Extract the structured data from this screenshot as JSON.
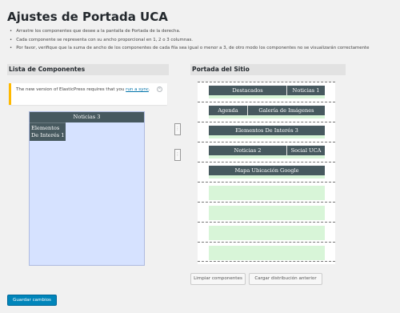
{
  "page": {
    "title": "Ajustes de Portada UCA",
    "instructions": [
      "Arrastre los componentes que desee a la pantalla de Portada de la derecha.",
      "Cada componente se representa con su ancho proporcional en 1, 2 o 3 columnas.",
      "Por favor, verifique que la suma de ancho de los componentes de cada fila sea igual o menor a 3, de otro modo los componentes no se visualizarán correctamente"
    ]
  },
  "left_panel": {
    "heading": "Lista de Componentes",
    "notice": {
      "text_before": "The new version of ElasticPress requires that you ",
      "link_text": "run a sync",
      "text_after": ".",
      "dismiss_icon": "close-circle-icon"
    },
    "pool": {
      "items": [
        "Noticias 3",
        "Elementos De Interés 1"
      ]
    }
  },
  "right_panel": {
    "heading": "Portada del Sitio",
    "rows": [
      [
        "Destacados",
        "Noticias 1"
      ],
      [
        "Agenda",
        "Galería de Imágenes"
      ],
      [
        "Elementos De Interés 3"
      ],
      [
        "Noticias 2",
        "Social UCA"
      ],
      [
        "Mapa Ubicación Google"
      ]
    ]
  },
  "buttons": {
    "clear": "Limpiar componentes",
    "load": "Cargar distribución anterior",
    "save": "Guardar cambios"
  },
  "colors": {
    "block": "#47595f",
    "pool": "#d6e2ff",
    "slot": "#d8f5d8",
    "primary": "#0085ba",
    "notice_accent": "#ffb900"
  }
}
